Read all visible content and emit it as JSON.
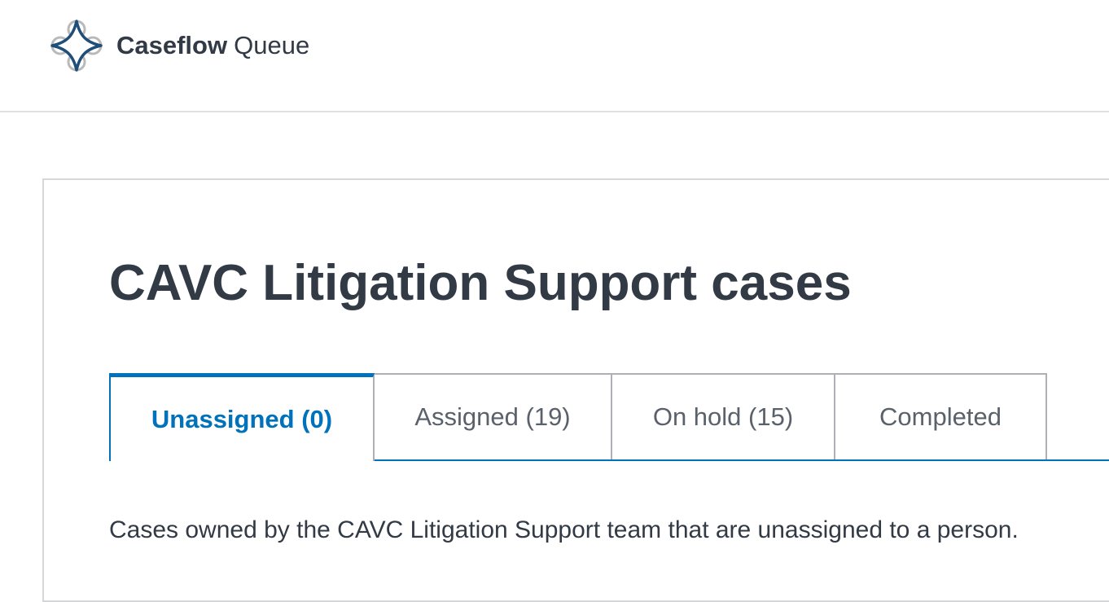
{
  "header": {
    "app_name": "Caseflow",
    "app_section": "Queue"
  },
  "page": {
    "title": "CAVC Litigation Support cases",
    "description": "Cases owned by the CAVC Litigation Support team that are unassigned to a person."
  },
  "tabs": [
    {
      "label": "Unassigned (0)",
      "active": true
    },
    {
      "label": "Assigned (19)",
      "active": false
    },
    {
      "label": "On hold (15)",
      "active": false
    },
    {
      "label": "Completed",
      "active": false
    }
  ],
  "colors": {
    "accent": "#0071bb",
    "text": "#323a45",
    "muted_text": "#5b616b",
    "border": "#aeb0b5",
    "logo_primary": "#1f4e79",
    "logo_secondary": "#b9b9b9"
  },
  "icons": {
    "logo": "caseflow-logo-icon"
  }
}
